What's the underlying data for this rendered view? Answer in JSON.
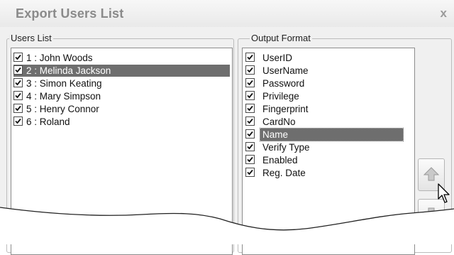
{
  "window": {
    "title": "Export Users List",
    "close_label": "x"
  },
  "users_group": {
    "legend": "Users List",
    "items": [
      {
        "label": "1 : John Woods",
        "checked": true,
        "selected": false
      },
      {
        "label": "2 : Melinda Jackson",
        "checked": true,
        "selected": true
      },
      {
        "label": "3 : Simon Keating",
        "checked": true,
        "selected": false
      },
      {
        "label": "4 : Mary Simpson",
        "checked": true,
        "selected": false
      },
      {
        "label": "5 : Henry Connor",
        "checked": true,
        "selected": false
      },
      {
        "label": "6 : Roland",
        "checked": true,
        "selected": false
      }
    ]
  },
  "format_group": {
    "legend": "Output Format",
    "items": [
      {
        "label": "UserID",
        "checked": true,
        "selected": false
      },
      {
        "label": "UserName",
        "checked": true,
        "selected": false
      },
      {
        "label": "Password",
        "checked": true,
        "selected": false
      },
      {
        "label": "Privilege",
        "checked": true,
        "selected": false
      },
      {
        "label": "Fingerprint",
        "checked": true,
        "selected": false
      },
      {
        "label": "CardNo",
        "checked": true,
        "selected": false
      },
      {
        "label": "Name",
        "checked": true,
        "selected": true
      },
      {
        "label": "Verify Type",
        "checked": true,
        "selected": false
      },
      {
        "label": "Enabled",
        "checked": true,
        "selected": false
      },
      {
        "label": "Reg. Date",
        "checked": true,
        "selected": false
      }
    ]
  },
  "buttons": {
    "move_up_icon": "arrow-up-icon",
    "move_down_icon": "arrow-down-icon"
  }
}
